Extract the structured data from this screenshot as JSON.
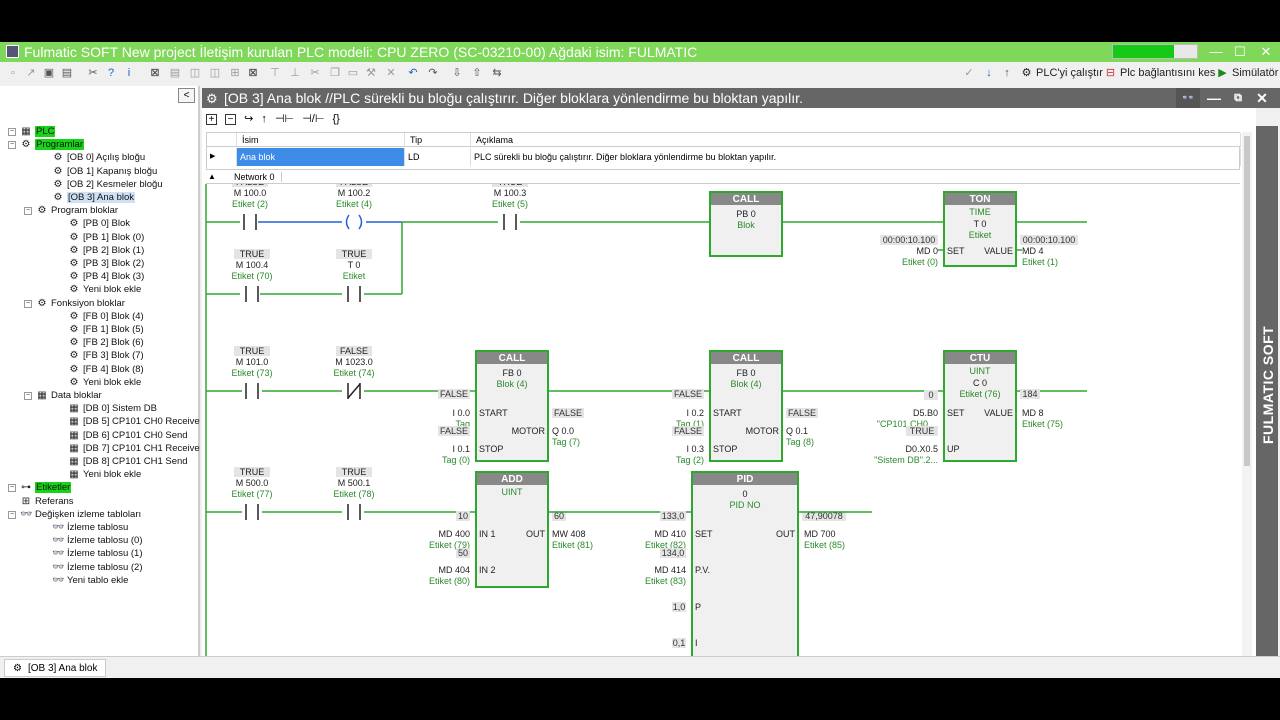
{
  "window": {
    "title": "Fulmatic SOFT New project İletişim kurulan PLC modeli: CPU ZERO (SC-03210-00) Ağdaki isim: FULMATIC",
    "progress": 0.73,
    "minimize": "—",
    "maximize": "☐",
    "close": "✕",
    "accent": "#7fd85a"
  },
  "toolbar": {
    "run_label": "PLC'yi çalıştır",
    "disconnect_label": "Plc bağlantısını kes",
    "simulator_label": "Simülatör"
  },
  "sidebar": {
    "collapse": "<",
    "items": [
      {
        "label": "PLC",
        "icon": "grid-icon",
        "indent": 0,
        "style": "hl"
      },
      {
        "label": "Programlar",
        "icon": "gear-icon",
        "indent": 0,
        "style": "hl"
      },
      {
        "label": "[OB 0] Açılış bloğu",
        "icon": "gear-icon",
        "indent": 2,
        "style": ""
      },
      {
        "label": "[OB 1] Kapanış bloğu",
        "icon": "gear-icon",
        "indent": 2,
        "style": ""
      },
      {
        "label": "[OB 2] Kesmeler bloğu",
        "icon": "gear-icon",
        "indent": 2,
        "style": ""
      },
      {
        "label": "[OB 3] Ana blok",
        "icon": "gear-icon",
        "indent": 2,
        "style": "sel"
      },
      {
        "label": "Program bloklar",
        "icon": "gear-icon",
        "indent": 1,
        "style": ""
      },
      {
        "label": "[PB 0] Blok",
        "icon": "gear-icon",
        "indent": 3,
        "style": ""
      },
      {
        "label": "[PB 1] Blok (0)",
        "icon": "gear-icon",
        "indent": 3,
        "style": ""
      },
      {
        "label": "[PB 2] Blok (1)",
        "icon": "gear-icon",
        "indent": 3,
        "style": ""
      },
      {
        "label": "[PB 3] Blok (2)",
        "icon": "gear-icon",
        "indent": 3,
        "style": ""
      },
      {
        "label": "[PB 4] Blok (3)",
        "icon": "gear-icon",
        "indent": 3,
        "style": ""
      },
      {
        "label": "Yeni blok ekle",
        "icon": "add-gear-icon",
        "indent": 3,
        "style": ""
      },
      {
        "label": "Fonksiyon bloklar",
        "icon": "gear-icon",
        "indent": 1,
        "style": ""
      },
      {
        "label": "[FB 0] Blok (4)",
        "icon": "gear-icon",
        "indent": 3,
        "style": ""
      },
      {
        "label": "[FB 1] Blok (5)",
        "icon": "gear-icon",
        "indent": 3,
        "style": ""
      },
      {
        "label": "[FB 2] Blok (6)",
        "icon": "gear-icon",
        "indent": 3,
        "style": ""
      },
      {
        "label": "[FB 3] Blok (7)",
        "icon": "gear-icon",
        "indent": 3,
        "style": ""
      },
      {
        "label": "[FB 4] Blok (8)",
        "icon": "gear-icon",
        "indent": 3,
        "style": ""
      },
      {
        "label": "Yeni blok ekle",
        "icon": "add-gear-icon",
        "indent": 3,
        "style": ""
      },
      {
        "label": "Data bloklar",
        "icon": "table-icon",
        "indent": 1,
        "style": ""
      },
      {
        "label": "[DB 0] Sistem DB",
        "icon": "table-icon",
        "indent": 3,
        "style": ""
      },
      {
        "label": "[DB 5] CP101 CH0 Receive",
        "icon": "table-icon",
        "indent": 3,
        "style": ""
      },
      {
        "label": "[DB 6] CP101 CH0 Send",
        "icon": "table-icon",
        "indent": 3,
        "style": ""
      },
      {
        "label": "[DB 7] CP101 CH1 Receive",
        "icon": "table-icon",
        "indent": 3,
        "style": ""
      },
      {
        "label": "[DB 8] CP101 CH1 Send",
        "icon": "table-icon",
        "indent": 3,
        "style": ""
      },
      {
        "label": "Yeni blok ekle",
        "icon": "add-table-icon",
        "indent": 3,
        "style": ""
      },
      {
        "label": "Etiketler",
        "icon": "tag-icon",
        "indent": 0,
        "style": "hl"
      },
      {
        "label": "Referans",
        "icon": "reference-icon",
        "indent": 0,
        "style": ""
      },
      {
        "label": "Değişken izleme tabloları",
        "icon": "glasses-icon",
        "indent": 0,
        "style": ""
      },
      {
        "label": "İzleme tablosu",
        "icon": "glasses-icon",
        "indent": 2,
        "style": ""
      },
      {
        "label": "İzleme tablosu (0)",
        "icon": "glasses-icon",
        "indent": 2,
        "style": ""
      },
      {
        "label": "İzleme tablosu (1)",
        "icon": "glasses-icon",
        "indent": 2,
        "style": ""
      },
      {
        "label": "İzleme tablosu (2)",
        "icon": "glasses-icon",
        "indent": 2,
        "style": ""
      },
      {
        "label": "Yeni tablo ekle",
        "icon": "add-glasses-icon",
        "indent": 2,
        "style": ""
      }
    ]
  },
  "panel": {
    "title": "[OB 3] Ana blok //PLC sürekli bu bloğu çalıştırır. Diğer bloklara yönlendirme bu bloktan yapılır.",
    "rail_label": "FULMATIC SOFT",
    "grid": {
      "col_name": "İsim",
      "col_type": "Tip",
      "col_desc": "Açıklama",
      "row_name": "Ana blok",
      "row_type": "LD",
      "row_desc": "PLC sürekli bu bloğu çalıştırır. Diğer bloklara yönlendirme bu bloktan yapılır."
    },
    "network_label": "Network 0"
  },
  "ladder": {
    "contacts": [
      {
        "id": "c1",
        "state": "FALSE",
        "addr": "M 100.0",
        "tag": "Etiket (2)",
        "kind": "no"
      },
      {
        "id": "c2",
        "state": "FALSE",
        "addr": "M 100.2",
        "tag": "Etiket (4)",
        "kind": "coil"
      },
      {
        "id": "c3",
        "state": "TRUE",
        "addr": "M 100.3",
        "tag": "Etiket (5)",
        "kind": "no"
      },
      {
        "id": "c4",
        "state": "TRUE",
        "addr": "M 100.4",
        "tag": "Etiket (70)",
        "kind": "no"
      },
      {
        "id": "c5",
        "state": "TRUE",
        "addr": "T 0",
        "tag": "Etiket",
        "kind": "no"
      },
      {
        "id": "c6",
        "state": "TRUE",
        "addr": "M 101.0",
        "tag": "Etiket (73)",
        "kind": "no"
      },
      {
        "id": "c7",
        "state": "FALSE",
        "addr": "M 1023.0",
        "tag": "Etiket (74)",
        "kind": "nc"
      },
      {
        "id": "c8",
        "state": "TRUE",
        "addr": "M 500.0",
        "tag": "Etiket (77)",
        "kind": "no"
      },
      {
        "id": "c9",
        "state": "TRUE",
        "addr": "M 500.1",
        "tag": "Etiket (78)",
        "kind": "no"
      }
    ],
    "blocks": {
      "call1": {
        "title": "CALL",
        "sub": "PB 0",
        "name": "Blok"
      },
      "ton": {
        "title": "TON",
        "type": "TIME",
        "sub": "T 0",
        "name": "Etiket",
        "set": "SET",
        "value": "VALUE",
        "in_val": "00:00:10.100",
        "in_addr": "MD 0",
        "in_tag": "Etiket (0)",
        "out_val": "00:00:10.100",
        "out_addr": "MD 4",
        "out_tag": "Etiket (1)"
      },
      "call2": {
        "title": "CALL",
        "sub": "FB 0",
        "name": "Blok (4)",
        "start": "START",
        "stop": "STOP",
        "motor": "MOTOR",
        "s_state": "FALSE",
        "s_addr": "I 0.0",
        "s_tag": "Tag",
        "t_state": "FALSE",
        "t_addr": "I 0.1",
        "t_tag": "Tag (0)",
        "m_state": "FALSE",
        "m_addr": "Q 0.0",
        "m_tag": "Tag (7)"
      },
      "call3": {
        "title": "CALL",
        "sub": "FB 0",
        "name": "Blok (4)",
        "start": "START",
        "stop": "STOP",
        "motor": "MOTOR",
        "s_state": "FALSE",
        "s_addr": "I 0.2",
        "s_tag": "Tag (1)",
        "t_state": "FALSE",
        "t_addr": "I 0.3",
        "t_tag": "Tag (2)",
        "m_state": "FALSE",
        "m_addr": "Q 0.1",
        "m_tag": "Tag (8)"
      },
      "ctu": {
        "title": "CTU",
        "type": "UINT",
        "sub": "C 0",
        "name": "Etiket (76)",
        "set": "SET",
        "value": "VALUE",
        "up": "UP",
        "set_val": "0",
        "set_addr": "D5.B0",
        "set_tag": "\"CP101 CH0 ...",
        "up_state": "TRUE",
        "up_addr": "D0.X0.5",
        "up_tag": "\"Sistem DB\".2...",
        "out_val": "184",
        "out_addr": "MD 8",
        "out_tag": "Etiket (75)"
      },
      "add": {
        "title": "ADD",
        "type": "UINT",
        "in1": "IN 1",
        "in2": "IN 2",
        "out": "OUT",
        "in1_val": "10",
        "in1_addr": "MD 400",
        "in1_tag": "Etiket (79)",
        "in2_val": "50",
        "in2_addr": "MD 404",
        "in2_tag": "Etiket (80)",
        "out_val": "60",
        "out_addr": "MW 408",
        "out_tag": "Etiket (81)"
      },
      "pid": {
        "title": "PID",
        "sub": "0",
        "name": "PID NO",
        "set": "SET",
        "pv": "P.V.",
        "p": "P",
        "i": "I",
        "out": "OUT",
        "set_val": "133,0",
        "set_addr": "MD 410",
        "set_tag": "Etiket (82)",
        "pv_val": "134,0",
        "pv_addr": "MD 414",
        "pv_tag": "Etiket (83)",
        "p_val": "1,0",
        "i_val": "0,1",
        "out_val": "47,90078",
        "out_addr": "MD 700",
        "out_tag": "Etiket (85)"
      }
    }
  },
  "status": {
    "tab_label": "[OB 3] Ana blok"
  }
}
